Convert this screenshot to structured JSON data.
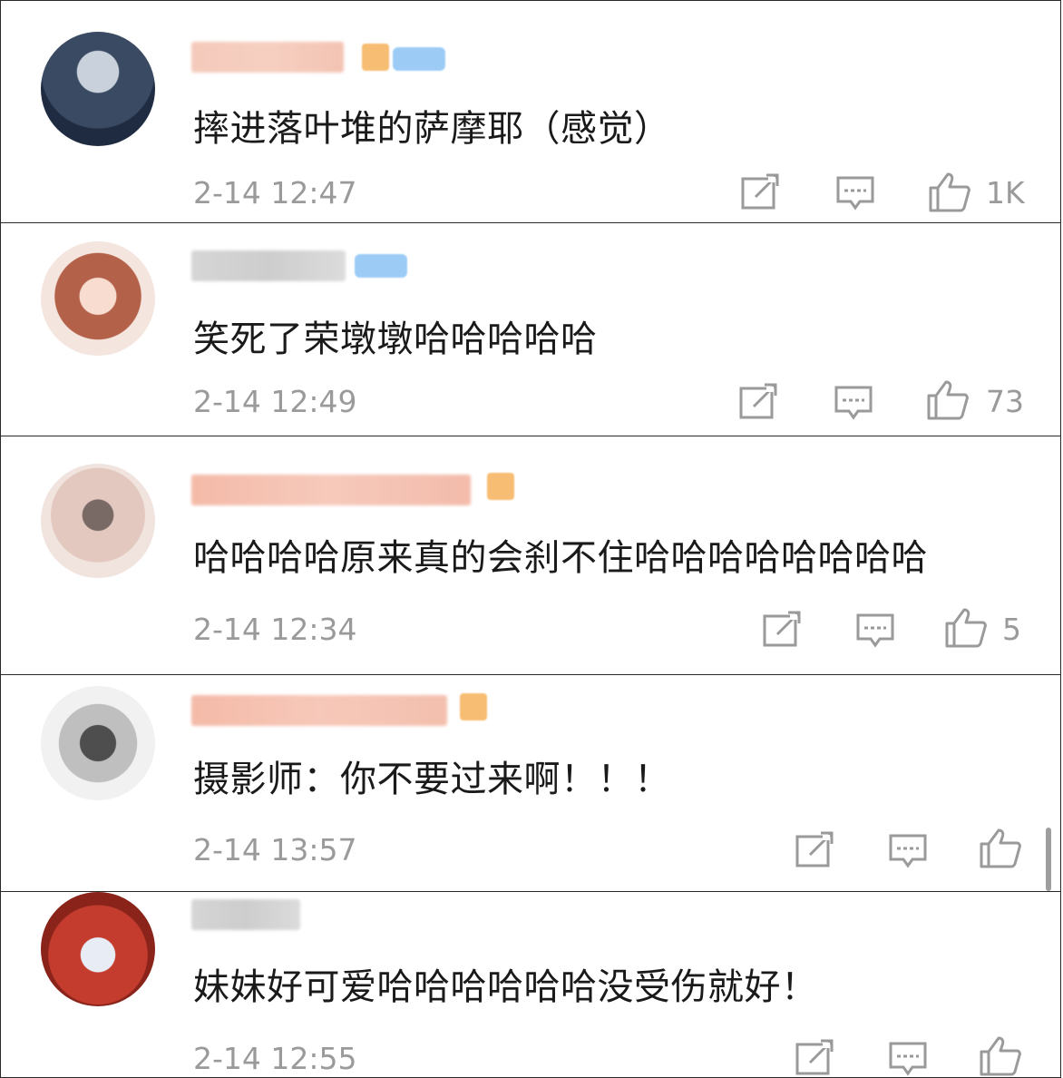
{
  "comments": [
    {
      "text": "摔进落叶堆的萨摩耶（感觉）",
      "time": "2-14 12:47",
      "likes": "1K"
    },
    {
      "text": "笑死了荣墩墩哈哈哈哈哈",
      "time": "2-14 12:49",
      "likes": "73"
    },
    {
      "text": "哈哈哈哈原来真的会刹不住哈哈哈哈哈哈哈哈",
      "time": "2-14 12:34",
      "likes": "5"
    },
    {
      "text": "摄影师：你不要过来啊！！！",
      "time": "2-14 13:57",
      "likes": ""
    },
    {
      "text": "妹妹好可爱哈哈哈哈哈哈没受伤就好！",
      "time": "2-14 12:55",
      "likes": ""
    }
  ],
  "icons": {
    "share": "share-icon",
    "reply": "comment-icon",
    "like": "thumbs-up-icon"
  },
  "colors": {
    "text": "#1a1a1a",
    "meta": "#9a9a9a",
    "border": "#2a2a2a"
  }
}
